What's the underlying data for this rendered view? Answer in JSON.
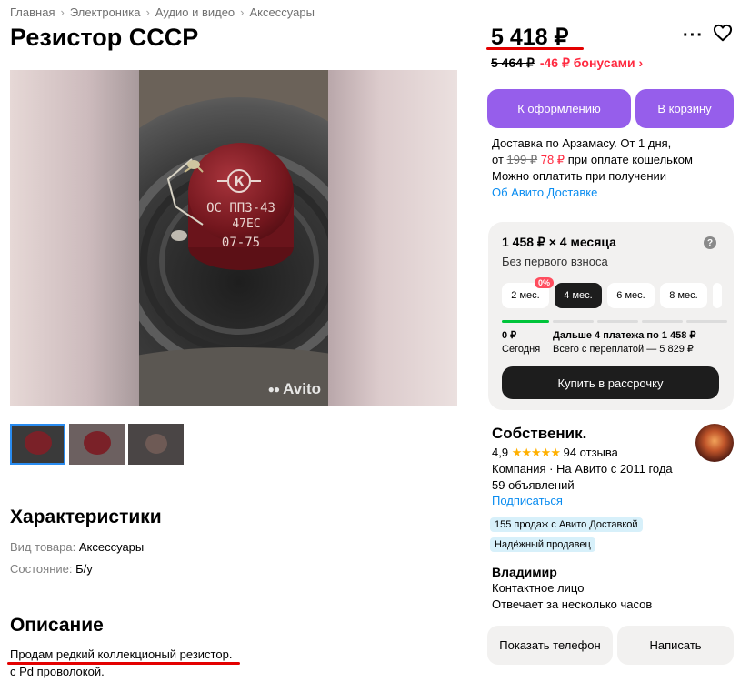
{
  "breadcrumb": [
    "Главная",
    "Электроника",
    "Аудио и видео",
    "Аксессуары"
  ],
  "title": "Резистор СССР",
  "photo": {
    "marking": [
      "ОС ПП3-43",
      "47ЕС",
      "07-75"
    ],
    "watermark": "Avito"
  },
  "characteristics": {
    "heading": "Характеристики",
    "items": [
      {
        "key": "Вид товара:",
        "value": "Аксессуары"
      },
      {
        "key": "Состояние:",
        "value": "Б/у"
      }
    ]
  },
  "description": {
    "heading": "Описание",
    "lines": [
      "Продам редкий коллекционый резистор.",
      "с Pd проволокой."
    ]
  },
  "price": {
    "current": "5 418 ₽",
    "old": "5 464 ₽",
    "bonus": "-46 ₽ бонусами ›"
  },
  "buttons": {
    "checkout": "К оформлению",
    "cart": "В корзину",
    "installment": "Купить в рассрочку",
    "phone": "Показать телефон",
    "message": "Написать"
  },
  "delivery": {
    "line1": "Доставка по Арзамасу. От 1 дня,",
    "from": "от",
    "old": "199 ₽",
    "new": "78 ₽",
    "wallet": "при оплате кошельком",
    "line3": "Можно оплатить при получении",
    "link": "Об Авито Доставке"
  },
  "installment": {
    "title": "1 458 ₽ × 4 месяца",
    "subtitle": "Без первого взноса",
    "badge": "0%",
    "chips": [
      "2 мес.",
      "4 мес.",
      "6 мес.",
      "8 мес."
    ],
    "selected": "4 мес.",
    "now_value": "0 ₽",
    "now_label": "Сегодня",
    "next_value": "Дальше 4 платежа по 1 458 ₽",
    "next_label": "Всего с переплатой — 5 829 ₽"
  },
  "seller": {
    "name": "Собственик.",
    "rating": "4,9",
    "stars": "★★★★★",
    "reviews": "94 отзыва",
    "since": "Компания · На Авито с 2011 года",
    "ads": "59 объявлений",
    "subscribe": "Подписаться",
    "tags": [
      "155 продаж с Авито Доставкой",
      "Надёжный продавец"
    ],
    "contact_name": "Владимир",
    "contact_role": "Контактное лицо",
    "response": "Отвечает за несколько часов"
  },
  "colors": {
    "accent": "#965eeb",
    "link": "#0a8cf0",
    "bonus": "#ff2a40",
    "success": "#00c43a"
  }
}
